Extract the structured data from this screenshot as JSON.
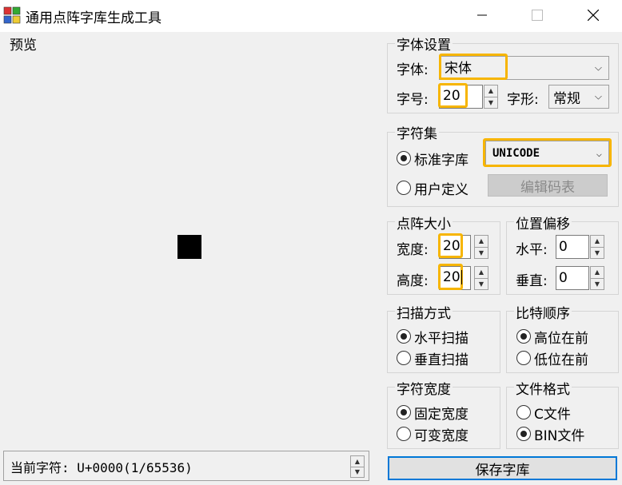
{
  "window": {
    "title": "通用点阵字库生成工具",
    "controls": [
      "minimize",
      "maximize",
      "close"
    ]
  },
  "preview": {
    "label": "预览",
    "status_text": "当前字符: U+0000(1/65536)"
  },
  "font_settings": {
    "title": "字体设置",
    "font_label": "字体:",
    "font_value": "宋体",
    "size_label": "字号:",
    "size_value": "20",
    "style_label": "字形:",
    "style_value": "常规"
  },
  "charset": {
    "title": "字符集",
    "standard_label": "标准字库",
    "standard_value": "UNICODE",
    "user_label": "用户定义",
    "edit_table_label": "编辑码表",
    "selected": "standard"
  },
  "matrix_size": {
    "title": "点阵大小",
    "width_label": "宽度:",
    "width_value": "20",
    "height_label": "高度:",
    "height_value": "20"
  },
  "offset": {
    "title": "位置偏移",
    "horizontal_label": "水平:",
    "horizontal_value": "0",
    "vertical_label": "垂直:",
    "vertical_value": "0"
  },
  "scan_mode": {
    "title": "扫描方式",
    "options": [
      "水平扫描",
      "垂直扫描"
    ],
    "selected": 0
  },
  "bit_order": {
    "title": "比特顺序",
    "options": [
      "高位在前",
      "低位在前"
    ],
    "selected": 0
  },
  "char_width": {
    "title": "字符宽度",
    "options": [
      "固定宽度",
      "可变宽度"
    ],
    "selected": 0
  },
  "file_format": {
    "title": "文件格式",
    "options": [
      "C文件",
      "BIN文件"
    ],
    "selected": 1
  },
  "save_label": "保存字库",
  "colors": {
    "highlight": "#f7b500",
    "focus_border": "#0078d7",
    "window_bg": "#f0f0f0"
  }
}
